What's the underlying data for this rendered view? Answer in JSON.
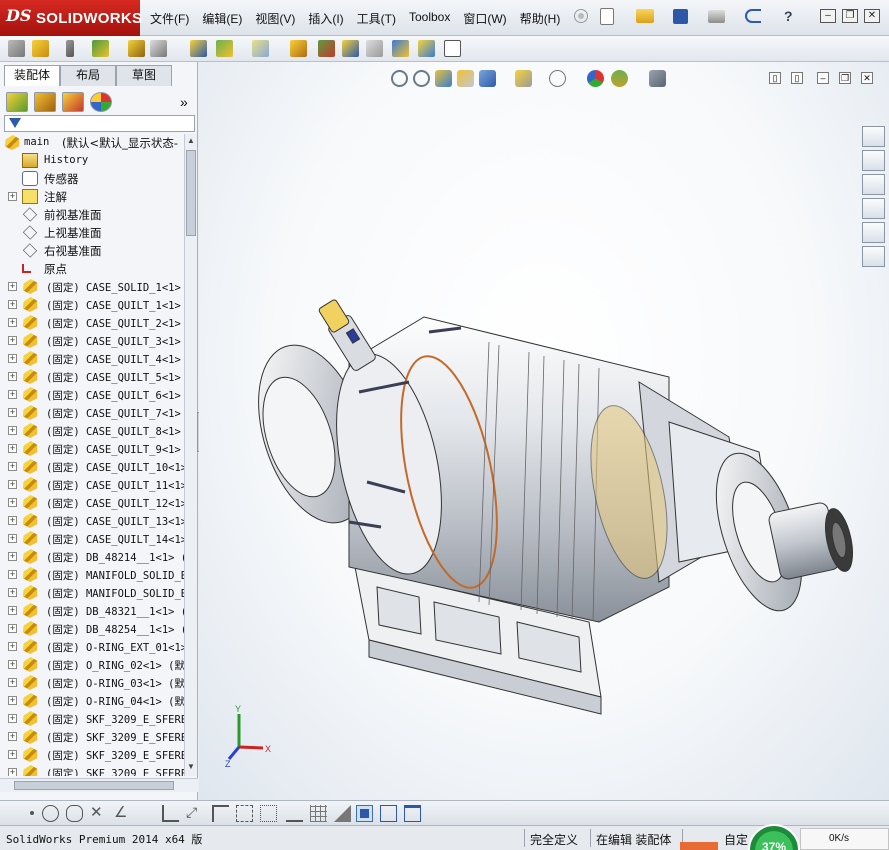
{
  "app": {
    "logo_prefix": "DS",
    "logo_text": "SOLIDWORKS"
  },
  "menubar": {
    "items": [
      "文件(F)",
      "编辑(E)",
      "视图(V)",
      "插入(I)",
      "工具(T)",
      "Toolbox",
      "窗口(W)",
      "帮助(H)"
    ]
  },
  "feature_manager": {
    "tabs": [
      "装配体",
      "布局",
      "草图"
    ],
    "active_tab": "装配体",
    "expand_arrows": "»",
    "root": {
      "name": "main",
      "config": "(默认<默认_显示状态-"
    },
    "special_items": [
      {
        "label": "History",
        "icon": "history-folder-icon"
      },
      {
        "label": "传感器",
        "icon": "sensor-icon"
      },
      {
        "label": "注解",
        "icon": "annotation-icon"
      },
      {
        "label": "前视基准面",
        "icon": "plane-icon"
      },
      {
        "label": "上视基准面",
        "icon": "plane-icon"
      },
      {
        "label": "右视基准面",
        "icon": "plane-icon"
      },
      {
        "label": "原点",
        "icon": "origin-icon"
      }
    ],
    "components": [
      "(固定) CASE_SOLID_1<1>",
      "(固定) CASE_QUILT_1<1>",
      "(固定) CASE_QUILT_2<1>",
      "(固定) CASE_QUILT_3<1>",
      "(固定) CASE_QUILT_4<1>",
      "(固定) CASE_QUILT_5<1>",
      "(固定) CASE_QUILT_6<1>",
      "(固定) CASE_QUILT_7<1>",
      "(固定) CASE_QUILT_8<1>",
      "(固定) CASE_QUILT_9<1>",
      "(固定) CASE_QUILT_10<1>",
      "(固定) CASE_QUILT_11<1>",
      "(固定) CASE_QUILT_12<1>",
      "(固定) CASE_QUILT_13<1>",
      "(固定) CASE_QUILT_14<1>",
      "(固定) DB_48214__1<1> (",
      "(固定) MANIFOLD_SOLID_B",
      "(固定) MANIFOLD_SOLID_B",
      "(固定) DB_48321__1<1> (",
      "(固定) DB_48254__1<1> (",
      "(固定) O-RING_EXT_01<1>",
      "(固定) O_RING_02<1> (默",
      "(固定) O-RING_03<1> (默",
      "(固定) O-RING_04<1> (默",
      "(固定) SKF_3209_E_SFERE",
      "(固定) SKF_3209_E_SFERE",
      "(固定) SKF_3209_E_SFERE",
      "(固定) SKF_3209_E_SFERE"
    ]
  },
  "triad": {
    "x_label": "X",
    "y_label": "Y",
    "z_label": "Z"
  },
  "statusbar": {
    "app_version": "SolidWorks Premium 2014 x64 版",
    "status_1": "完全定义",
    "status_2": "在编辑 装配体",
    "status_3": "自定",
    "cpu_percent": "37%",
    "net_speed": "0K/s"
  },
  "colors": {
    "brand_red": "#c21d16",
    "part_yellow": "#f2c030",
    "selection_blue": "#3b6fb6"
  }
}
